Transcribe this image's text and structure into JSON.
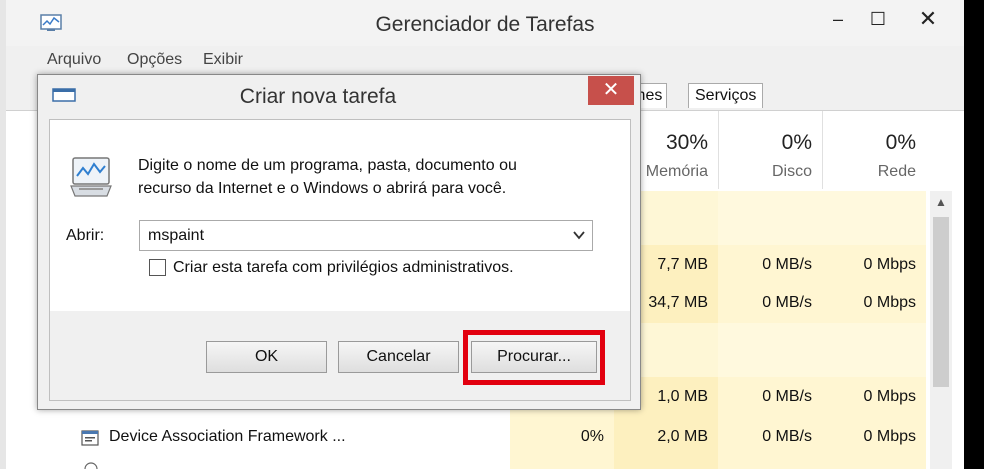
{
  "window": {
    "title": "Gerenciador de Tarefas",
    "controls": {
      "minimize": "–",
      "maximize": "☐",
      "close": "✕"
    }
  },
  "menu": [
    "Arquivo",
    "Opções",
    "Exibir"
  ],
  "tabs": [
    "lhes",
    "Serviços"
  ],
  "columns": [
    {
      "percent": "30%",
      "name": "Memória"
    },
    {
      "percent": "0%",
      "name": "Disco"
    },
    {
      "percent": "0%",
      "name": "Rede"
    }
  ],
  "rows": [
    {
      "name": "",
      "cpu": "",
      "memory": "",
      "disk": "",
      "network": ""
    },
    {
      "name": "",
      "cpu": "",
      "memory": "7,7 MB",
      "disk": "0 MB/s",
      "network": "0 Mbps"
    },
    {
      "name": "",
      "cpu": "",
      "memory": "34,7 MB",
      "disk": "0 MB/s",
      "network": "0 Mbps"
    },
    {
      "name": "",
      "cpu": "",
      "memory": "",
      "disk": "",
      "network": ""
    },
    {
      "name": "",
      "cpu": "",
      "memory": "1,0 MB",
      "disk": "0 MB/s",
      "network": "0 Mbps"
    },
    {
      "name": "Device Association Framework ...",
      "cpu": "0%",
      "memory": "2,0 MB",
      "disk": "0 MB/s",
      "network": "0 Mbps"
    }
  ],
  "dialog": {
    "title": "Criar nova tarefa",
    "close": "✕",
    "message_line1": "Digite o nome de um programa, pasta, documento ou",
    "message_line2": "recurso da Internet e o Windows o abrirá para você.",
    "open_label": "Abrir:",
    "open_value": "mspaint",
    "admin_checkbox_label": "Criar esta tarefa com privilégios administrativos.",
    "admin_checked": false,
    "buttons": {
      "ok": "OK",
      "cancel": "Cancelar",
      "browse": "Procurar..."
    }
  },
  "colors": {
    "highlight": "#e2000f",
    "close_button": "#c7504b",
    "heat": "#fff6d2",
    "heat_strong": "#fdf0bf"
  },
  "scrollbar": {
    "up_arrow": "▲"
  }
}
